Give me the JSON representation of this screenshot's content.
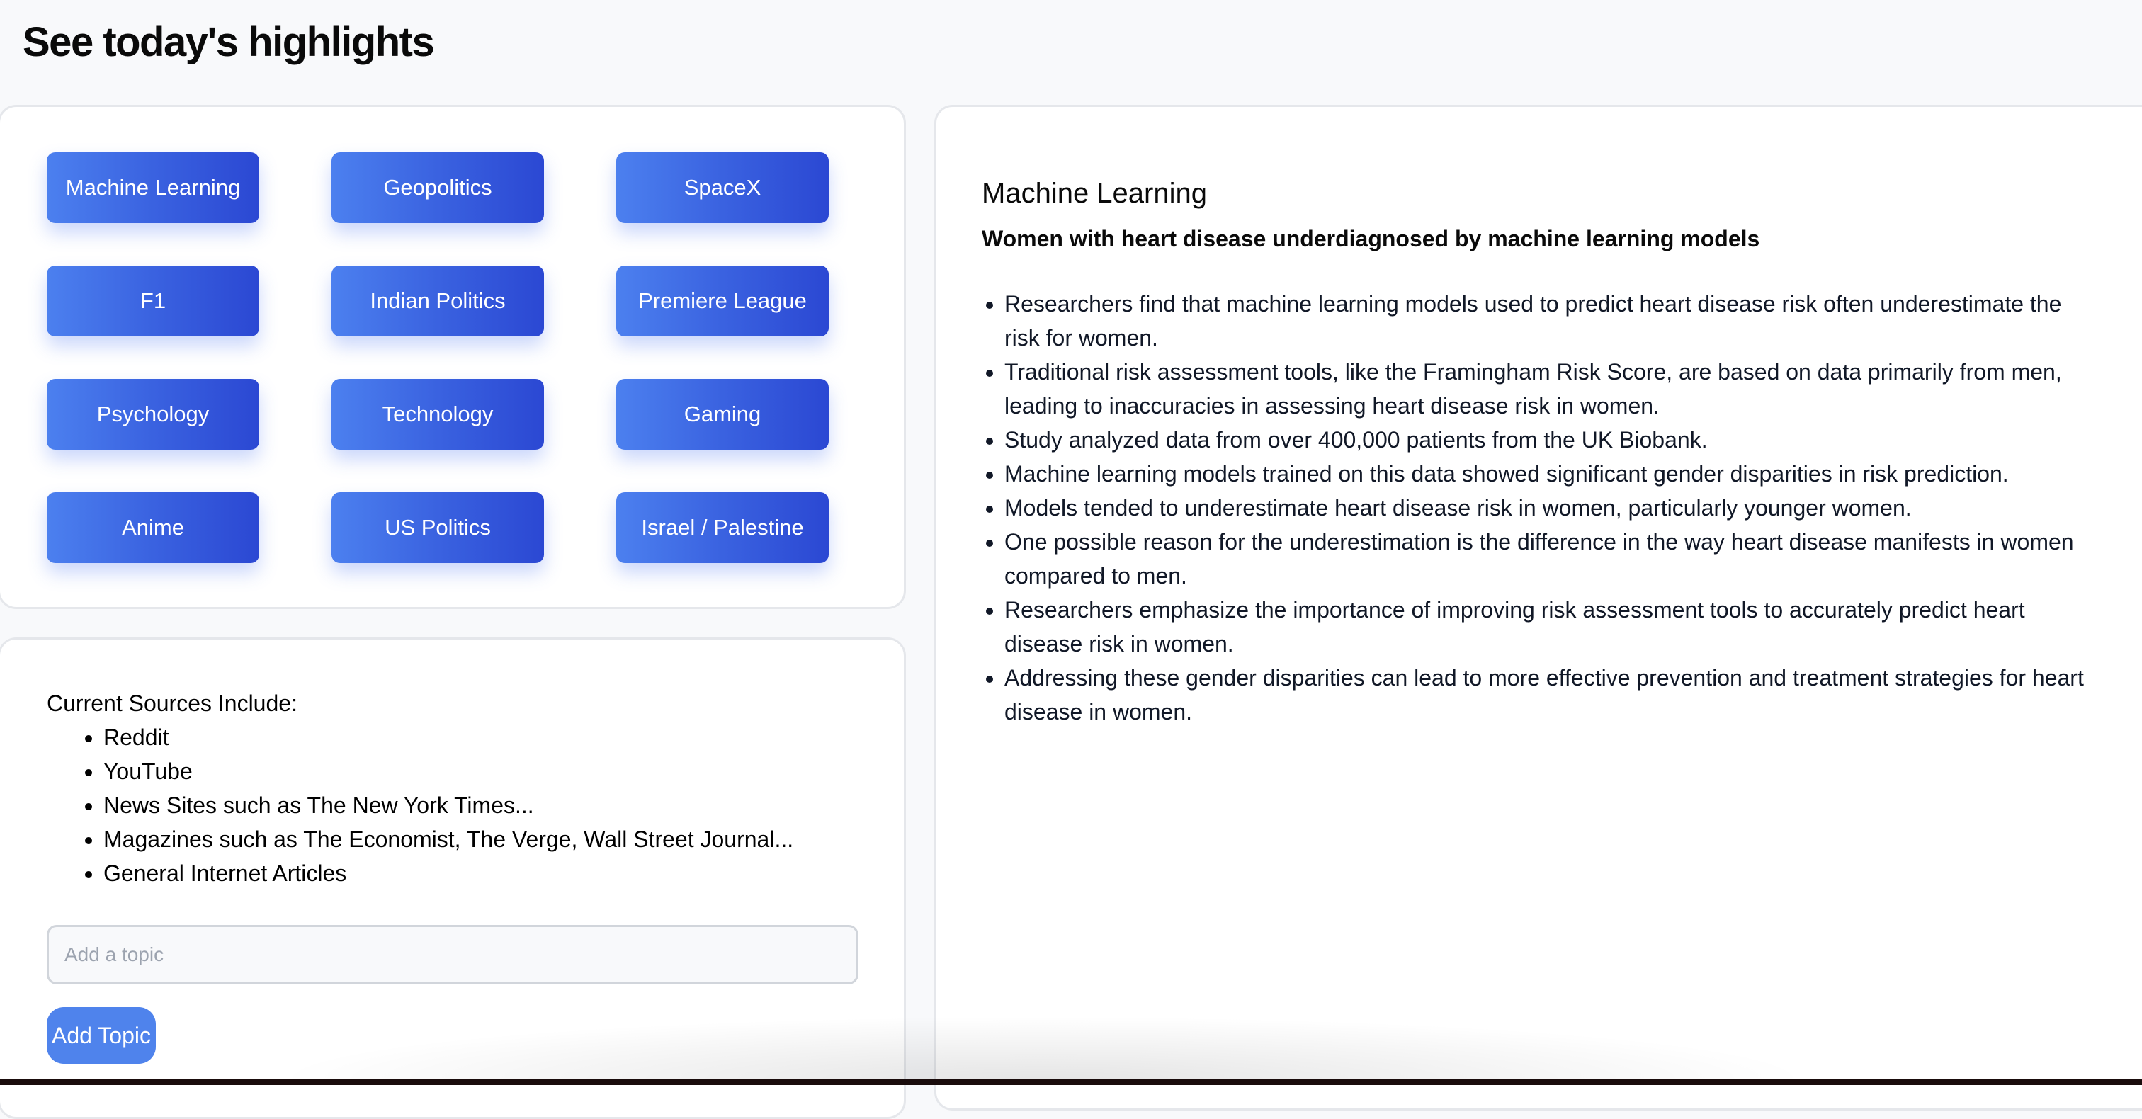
{
  "header": {
    "title": "See today's highlights"
  },
  "topics": [
    {
      "label": "Machine Learning"
    },
    {
      "label": "Geopolitics"
    },
    {
      "label": "SpaceX"
    },
    {
      "label": "F1"
    },
    {
      "label": "Indian Politics"
    },
    {
      "label": "Premiere League"
    },
    {
      "label": "Psychology"
    },
    {
      "label": "Technology"
    },
    {
      "label": "Gaming"
    },
    {
      "label": "Anime"
    },
    {
      "label": "US Politics"
    },
    {
      "label": "Israel / Palestine"
    }
  ],
  "sources": {
    "heading": "Current Sources Include:",
    "items": [
      "Reddit",
      "YouTube",
      "News Sites such as The New York Times...",
      "Magazines such as The Economist, The Verge, Wall Street Journal...",
      "General Internet Articles"
    ]
  },
  "add_topic": {
    "input_value": "",
    "input_placeholder": "Add a topic",
    "button_label": "Add Topic"
  },
  "article": {
    "topic": "Machine Learning",
    "headline": "Women with heart disease underdiagnosed by machine learning models",
    "points": [
      "Researchers find that machine learning models used to predict heart disease risk often underestimate the risk for women.",
      "Traditional risk assessment tools, like the Framingham Risk Score, are based on data primarily from men, leading to inaccuracies in assessing heart disease risk in women.",
      "Study analyzed data from over 400,000 patients from the UK Biobank.",
      "Machine learning models trained on this data showed significant gender disparities in risk prediction.",
      "Models tended to underestimate heart disease risk in women, particularly younger women.",
      "One possible reason for the underestimation is the difference in the way heart disease manifests in women compared to men.",
      "Researchers emphasize the importance of improving risk assessment tools to accurately predict heart disease risk in women.",
      "Addressing these gender disparities can lead to more effective prevention and treatment strategies for heart disease in women."
    ]
  },
  "colors": {
    "page_background": "#f8f9fb",
    "topic_gradient_start": "#4c80ef",
    "topic_gradient_end": "#2b48d3",
    "add_button": "#4f83ec",
    "card_border": "#e5e7eb"
  }
}
